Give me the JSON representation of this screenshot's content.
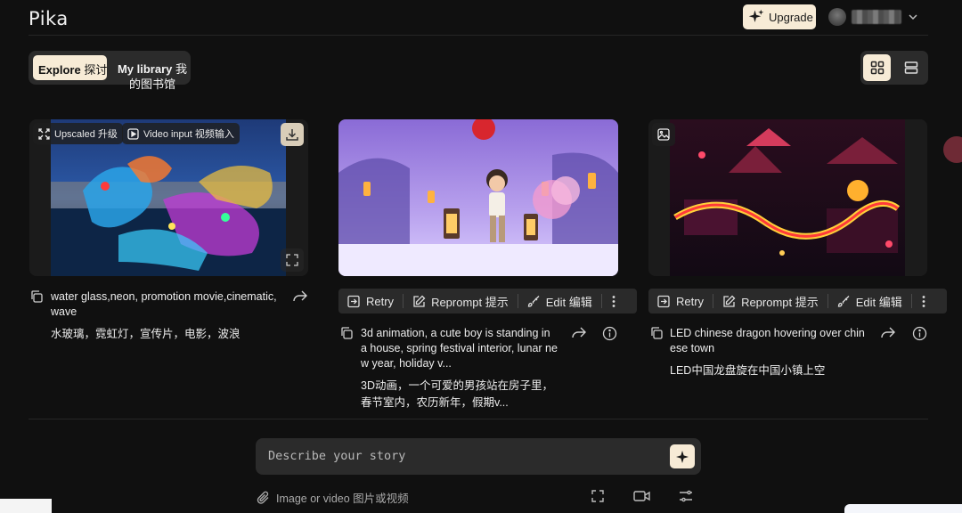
{
  "header": {
    "logo": "Pika",
    "upgrade_label": "Upgrade"
  },
  "tabs": {
    "explore_en": "Explore",
    "explore_zh": "探讨",
    "library_en": "My library",
    "library_zh1": "我",
    "library_zh2": "的图书馆"
  },
  "cards": [
    {
      "badges": {
        "upscaled": "Upscaled 升级",
        "video_input": "Video input 视频输入"
      },
      "caption": "water glass,neon, promotion movie,cinematic,",
      "caption2": "wave",
      "caption_zh": "水玻璃，霓虹灯，宣传片，电影，波浪"
    },
    {
      "actions": {
        "retry": "Retry",
        "reprompt": "Reprompt 提示",
        "edit": "Edit 编辑"
      },
      "caption_lines": [
        "3d animation, a cute boy is standing in",
        "a house, spring festival interior, lunar ne",
        "w year, holiday v..."
      ],
      "caption_zh_lines": [
        "3D动画，一个可爱的男孩站在房子里，",
        "春节室内，农历新年，假期v..."
      ]
    },
    {
      "actions": {
        "retry": "Retry",
        "reprompt": "Reprompt 提示",
        "edit": "Edit 编辑"
      },
      "caption_lines": [
        "LED chinese dragon hovering over chin",
        "ese town"
      ],
      "caption_zh_lines": [
        "LED中国龙盘旋在中国小镇上空"
      ]
    }
  ],
  "composer": {
    "placeholder": "Describe your story",
    "attach_label": "Image or video 图片或视频"
  },
  "colors": {
    "background": "#101010",
    "accent": "#f7ebd6",
    "surface": "#2b2b2b"
  }
}
